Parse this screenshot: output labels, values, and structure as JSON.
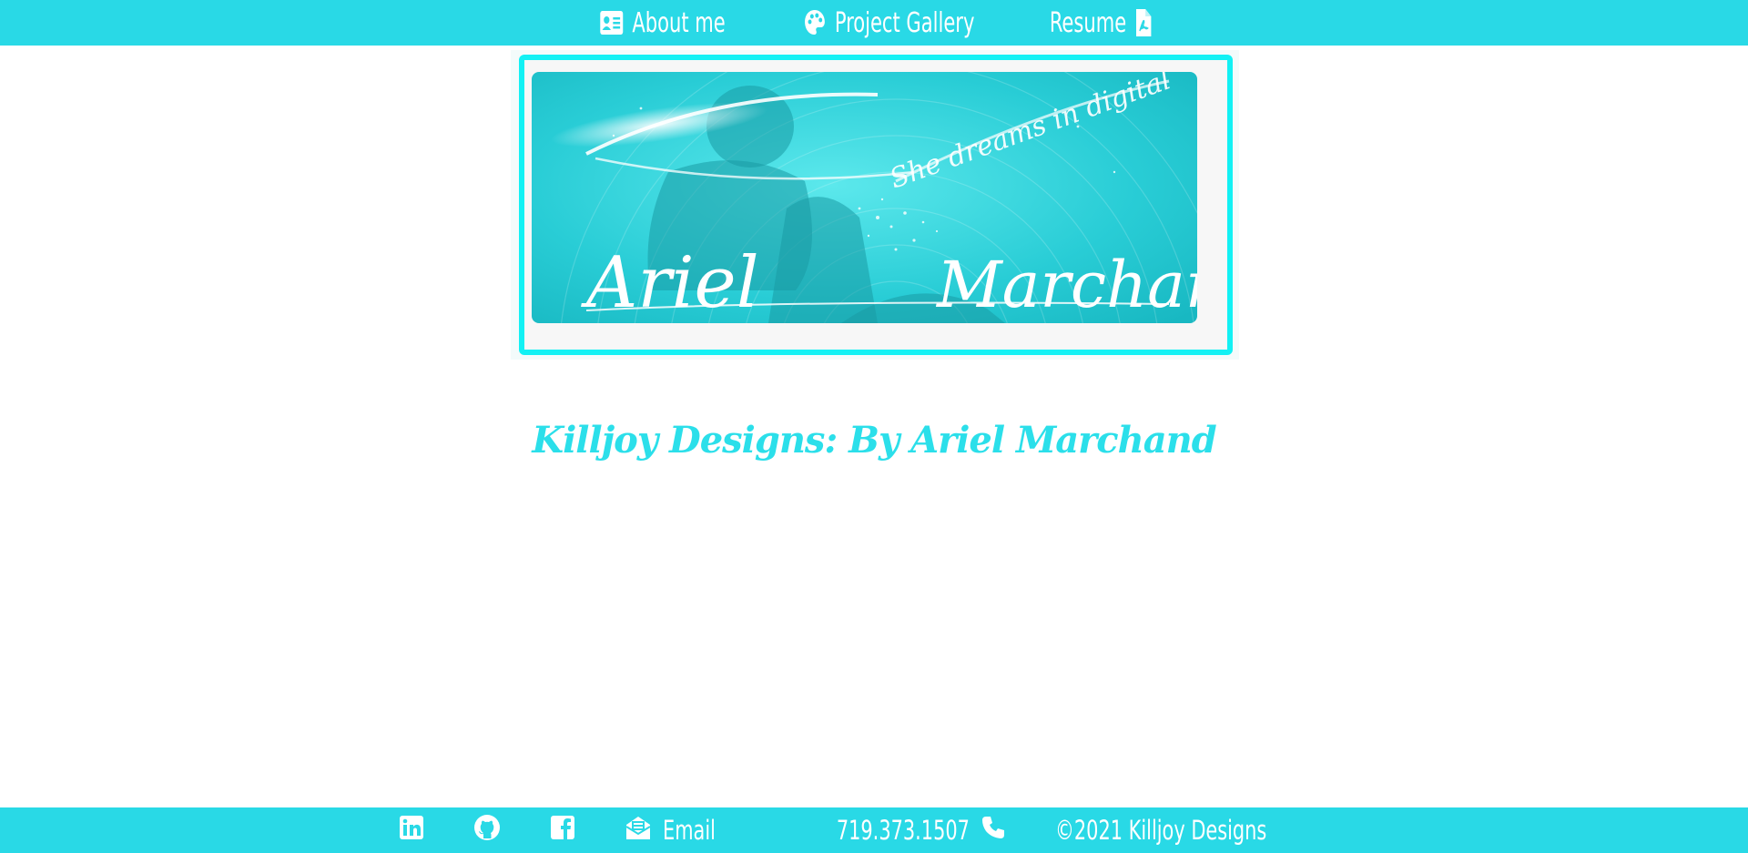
{
  "nav": {
    "items": [
      {
        "label": "About me",
        "icon": "address-card-icon"
      },
      {
        "label": "Project Gallery",
        "icon": "palette-icon"
      },
      {
        "label": "Resume",
        "icon": "pdf-file-icon"
      }
    ]
  },
  "banner": {
    "tagline": "She dreams in digital",
    "first_name": "Ariel",
    "last_name": "Marchand"
  },
  "main": {
    "title": "Killjoy Designs: By Ariel Marchand"
  },
  "footer": {
    "email_label": "Email",
    "phone": "719.373.1507",
    "copyright": "©2021 Killjoy Designs",
    "icons": [
      "linkedin-icon",
      "github-icon",
      "facebook-icon",
      "envelope-open-icon",
      "phone-icon"
    ]
  },
  "colors": {
    "accent": "#29d9e6",
    "frame": "#12f1f4",
    "title": "#2bdfea"
  }
}
